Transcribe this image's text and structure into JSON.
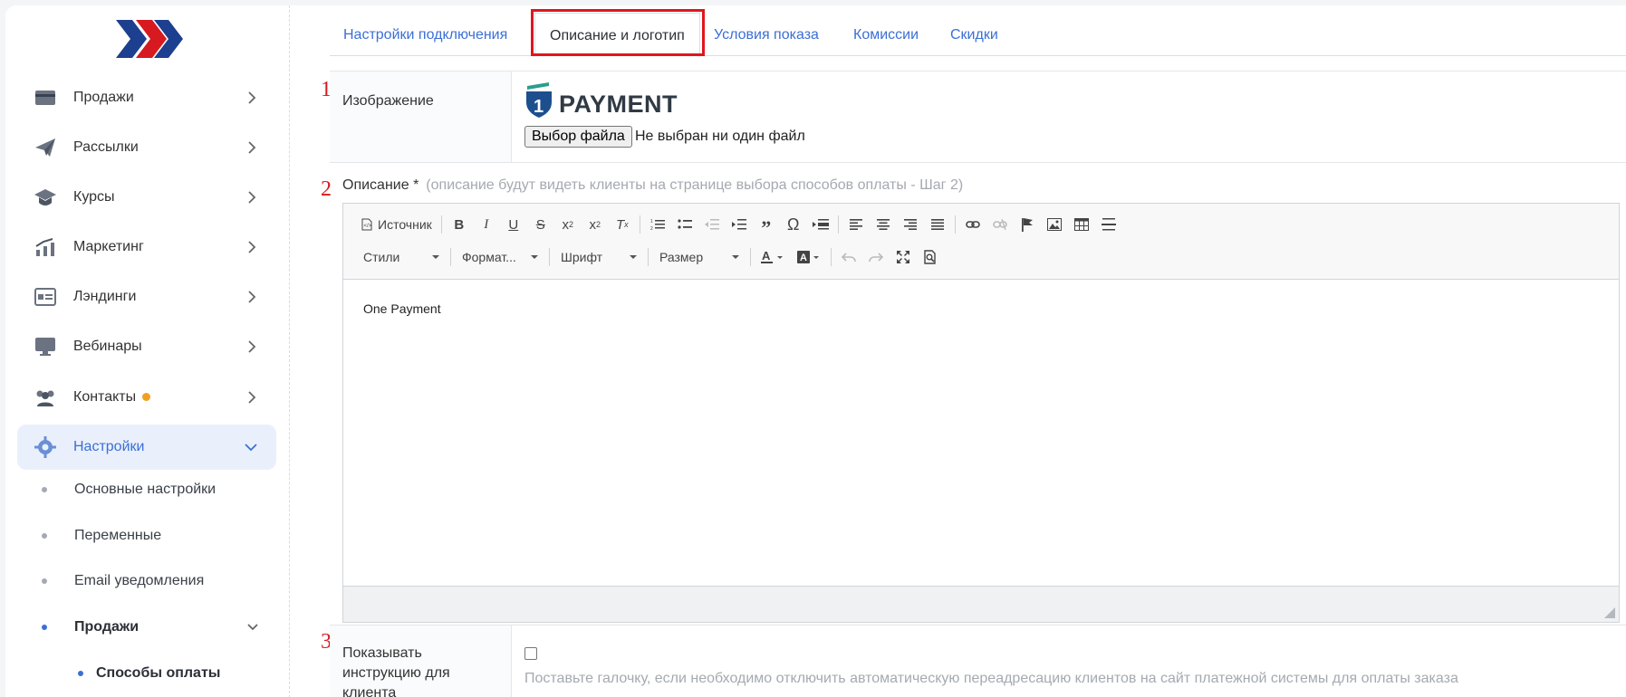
{
  "sidebar": {
    "items": [
      {
        "label": "Продажи",
        "icon": "card-icon"
      },
      {
        "label": "Рассылки",
        "icon": "paper-plane-icon"
      },
      {
        "label": "Курсы",
        "icon": "graduation-cap-icon"
      },
      {
        "label": "Маркетинг",
        "icon": "chart-up-icon"
      },
      {
        "label": "Лэндинги",
        "icon": "landing-page-icon"
      },
      {
        "label": "Вебинары",
        "icon": "monitor-icon"
      },
      {
        "label": "Контакты",
        "icon": "users-icon"
      },
      {
        "label": "Настройки",
        "icon": "gear-icon"
      }
    ],
    "subitems": [
      {
        "label": "Основные настройки"
      },
      {
        "label": "Переменные"
      },
      {
        "label": "Email уведомления"
      },
      {
        "label": "Продажи"
      }
    ],
    "subsubitems": [
      {
        "label": "Способы оплаты"
      }
    ]
  },
  "tabs": [
    {
      "label": "Настройки подключения"
    },
    {
      "label": "Описание и логотип"
    },
    {
      "label": "Условия показа"
    },
    {
      "label": "Комиссии"
    },
    {
      "label": "Скидки"
    }
  ],
  "annotations": {
    "n1": "1",
    "n2": "2",
    "n3": "3"
  },
  "image_row": {
    "label": "Изображение",
    "logo_text": "PAYMENT",
    "logo_digit": "1",
    "file_button": "Выбор файла",
    "file_status": "Не выбран ни один файл"
  },
  "description": {
    "label": "Описание *",
    "hint": "(описание будут видеть клиенты на странице выбора способов оплаты - Шаг 2)",
    "content": "One Payment"
  },
  "editor_toolbar": {
    "source_label": "Источник",
    "styles_label": "Стили",
    "format_label": "Формат...",
    "font_label": "Шрифт",
    "size_label": "Размер"
  },
  "instruction_row": {
    "label_line1": "Показывать",
    "label_line2": "инструкцию для",
    "label_line3": "клиента",
    "hint": "Поставьте галочку, если необходимо отключить автоматическую переадресацию клиентов на сайт платежной системы для оплаты заказа"
  },
  "colors": {
    "accent": "#3b6fd6",
    "highlight": "#e1151c",
    "badge": "#f0a020"
  }
}
